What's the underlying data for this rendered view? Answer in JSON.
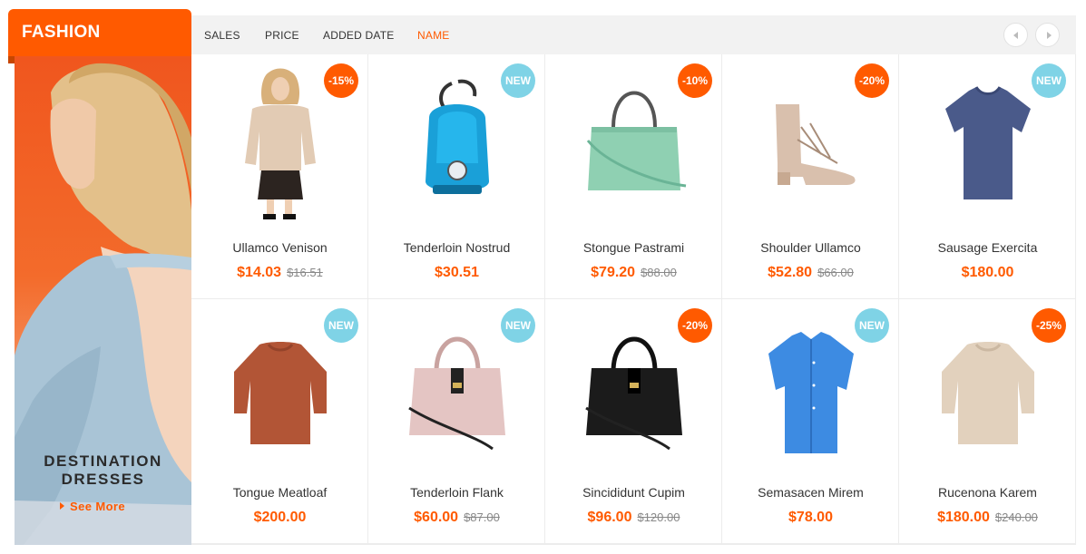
{
  "category": {
    "title": "FASHION",
    "banner_line1": "DESTINATION",
    "banner_line2": "DRESSES",
    "see_more": "See More"
  },
  "sort": {
    "items": [
      "SALES",
      "PRICE",
      "ADDED DATE",
      "NAME"
    ],
    "active": "NAME"
  },
  "colors": {
    "accent": "#ff5a00",
    "new_badge": "#7fd3e6"
  },
  "products": [
    {
      "name": "Ullamco Venison",
      "price": "$14.03",
      "old_price": "$16.51",
      "badge": "-15%",
      "icon": "cardigan-skirt-outfit-image"
    },
    {
      "name": "Tenderloin Nostrud",
      "price": "$30.51",
      "old_price": "",
      "badge": "NEW",
      "icon": "vacuum-cleaner-image"
    },
    {
      "name": "Stongue Pastrami",
      "price": "$79.20",
      "old_price": "$88.00",
      "badge": "-10%",
      "icon": "green-handbag-image"
    },
    {
      "name": "Shoulder Ullamco",
      "price": "$52.80",
      "old_price": "$66.00",
      "badge": "-20%",
      "icon": "lace-up-heel-shoe-image"
    },
    {
      "name": "Sausage Exercita",
      "price": "$180.00",
      "old_price": "",
      "badge": "NEW",
      "icon": "navy-tshirt-image"
    },
    {
      "name": "Tongue Meatloaf",
      "price": "$200.00",
      "old_price": "",
      "badge": "NEW",
      "icon": "rust-sweater-image"
    },
    {
      "name": "Tenderloin Flank",
      "price": "$60.00",
      "old_price": "$87.00",
      "badge": "NEW",
      "icon": "pink-handbag-image"
    },
    {
      "name": "Sincididunt Cupim",
      "price": "$96.00",
      "old_price": "$120.00",
      "badge": "-20%",
      "icon": "black-handbag-image"
    },
    {
      "name": "Semasacen Mirem",
      "price": "$78.00",
      "old_price": "",
      "badge": "NEW",
      "icon": "blue-shirt-image"
    },
    {
      "name": "Rucenona Karem",
      "price": "$180.00",
      "old_price": "$240.00",
      "badge": "-25%",
      "icon": "beige-sweater-image"
    }
  ]
}
